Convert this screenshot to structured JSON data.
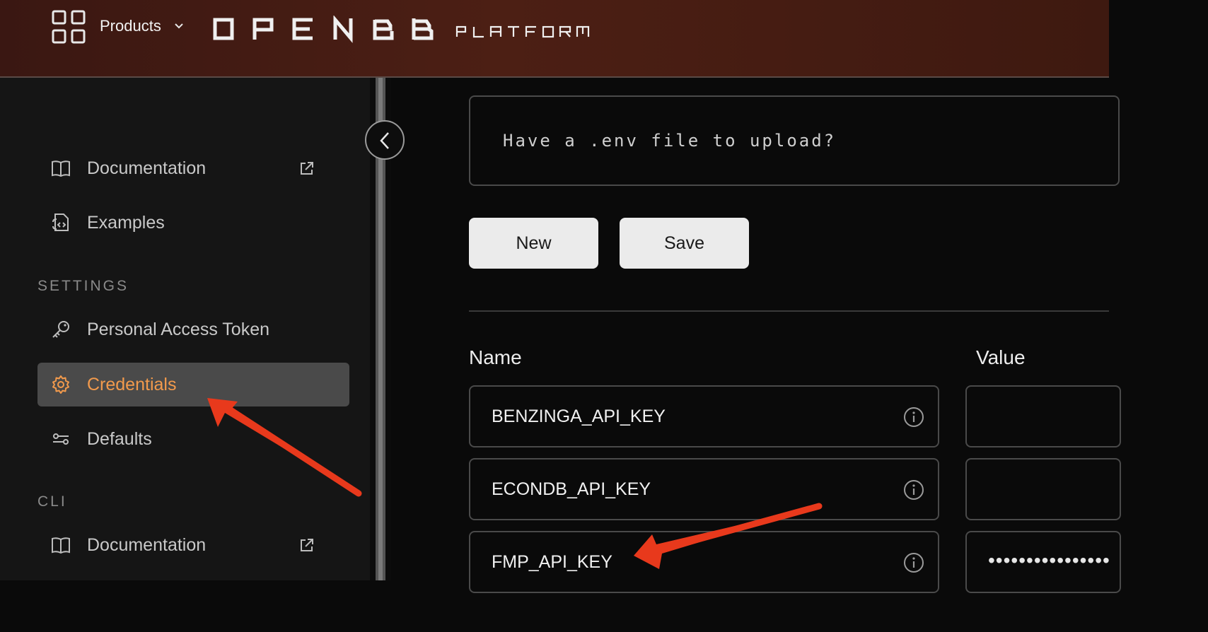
{
  "header": {
    "products_label": "Products",
    "logo_word": "OPENBB",
    "logo_sub": "PLATFORM"
  },
  "sidebar": {
    "items_top": [
      {
        "label": "Documentation",
        "icon": "book-icon",
        "external": true
      },
      {
        "label": "Examples",
        "icon": "code-file-icon",
        "external": false
      }
    ],
    "settings_label": "SETTINGS",
    "settings_items": [
      {
        "label": "Personal Access Token",
        "icon": "key-icon"
      },
      {
        "label": "Credentials",
        "icon": "gear-icon",
        "active": true
      },
      {
        "label": "Defaults",
        "icon": "sliders-icon"
      }
    ],
    "cli_label": "CLI",
    "cli_items": [
      {
        "label": "Documentation",
        "icon": "book-icon",
        "external": true
      }
    ]
  },
  "main": {
    "upload_prompt": "Have a .env file to upload?",
    "new_button": "New",
    "save_button": "Save",
    "columns": {
      "name": "Name",
      "value": "Value"
    },
    "credentials": [
      {
        "name": "BENZINGA_API_KEY",
        "value": ""
      },
      {
        "name": "ECONDB_API_KEY",
        "value": ""
      },
      {
        "name": "FMP_API_KEY",
        "value": "••••••••••••••••"
      }
    ]
  },
  "colors": {
    "accent_active": "#f29a4c",
    "annotation_arrow": "#e8391c",
    "header_bg": "#4c1f14"
  }
}
